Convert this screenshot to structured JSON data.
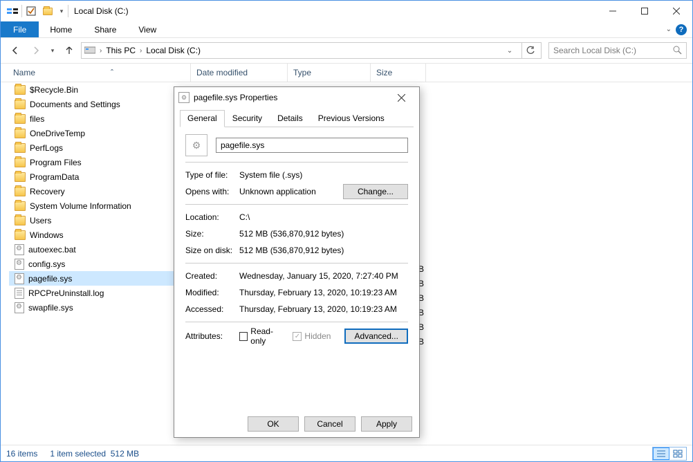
{
  "window": {
    "title": "Local Disk (C:)"
  },
  "ribbon": {
    "file": "File",
    "tabs": [
      "Home",
      "Share",
      "View"
    ]
  },
  "address": {
    "root": "This PC",
    "location": "Local Disk (C:)"
  },
  "search": {
    "placeholder": "Search Local Disk (C:)"
  },
  "columns": {
    "name": "Name",
    "date": "Date modified",
    "type": "Type",
    "size": "Size"
  },
  "items": [
    {
      "name": "$Recycle.Bin",
      "icon": "folder"
    },
    {
      "name": "Documents and Settings",
      "icon": "folder"
    },
    {
      "name": "files",
      "icon": "folder"
    },
    {
      "name": "OneDriveTemp",
      "icon": "folder"
    },
    {
      "name": "PerfLogs",
      "icon": "folder"
    },
    {
      "name": "Program Files",
      "icon": "folder"
    },
    {
      "name": "ProgramData",
      "icon": "folder"
    },
    {
      "name": "Recovery",
      "icon": "folder"
    },
    {
      "name": "System Volume Information",
      "icon": "folder"
    },
    {
      "name": "Users",
      "icon": "folder"
    },
    {
      "name": "Windows",
      "icon": "folder"
    },
    {
      "name": "autoexec.bat",
      "icon": "sys"
    },
    {
      "name": "config.sys",
      "icon": "sys"
    },
    {
      "name": "pagefile.sys",
      "icon": "sys",
      "selected": true
    },
    {
      "name": "RPCPreUninstall.log",
      "icon": "txt"
    },
    {
      "name": "swapfile.sys",
      "icon": "sys"
    }
  ],
  "partial_right": [
    "B",
    "B",
    "B",
    "B",
    "B",
    "B"
  ],
  "status": {
    "count": "16 items",
    "selection": "1 item selected",
    "size": "512 MB"
  },
  "dialog": {
    "title": "pagefile.sys Properties",
    "tabs": [
      "General",
      "Security",
      "Details",
      "Previous Versions"
    ],
    "filename": "pagefile.sys",
    "rows": {
      "typeoffile_k": "Type of file:",
      "typeoffile_v": "System file (.sys)",
      "openswith_k": "Opens with:",
      "openswith_v": "Unknown application",
      "change_btn": "Change...",
      "location_k": "Location:",
      "location_v": "C:\\",
      "size_k": "Size:",
      "size_v": "512 MB (536,870,912 bytes)",
      "sod_k": "Size on disk:",
      "sod_v": "512 MB (536,870,912 bytes)",
      "created_k": "Created:",
      "created_v": "Wednesday, January 15, 2020, 7:27:40 PM",
      "modified_k": "Modified:",
      "modified_v": "Thursday, February 13, 2020, 10:19:23 AM",
      "accessed_k": "Accessed:",
      "accessed_v": "Thursday, February 13, 2020, 10:19:23 AM",
      "attributes_k": "Attributes:",
      "readonly": "Read-only",
      "hidden": "Hidden",
      "advanced": "Advanced..."
    },
    "buttons": {
      "ok": "OK",
      "cancel": "Cancel",
      "apply": "Apply"
    }
  }
}
